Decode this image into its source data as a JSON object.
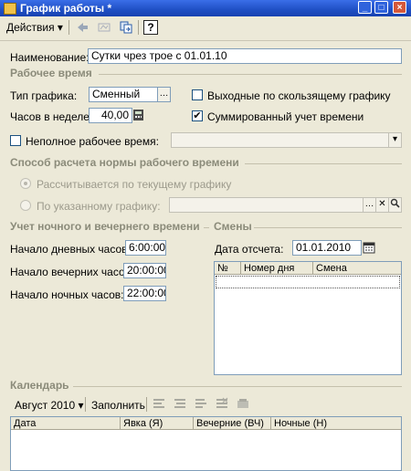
{
  "window": {
    "title": "График работы *"
  },
  "toolbar": {
    "actions_label": "Действия"
  },
  "form": {
    "name_label": "Наименование:",
    "name_value": "Сутки чрез трое с 01.01.10"
  },
  "work_time": {
    "title": "Рабочее время",
    "schedule_type_label": "Тип графика:",
    "schedule_type_value": "Сменный",
    "weekly_hours_label": "Часов в неделе:",
    "weekly_hours_value": "40,00",
    "sliding_weekends_label": "Выходные по скользящему графику",
    "sliding_weekends_checked": false,
    "summarized_label": "Суммированный учет времени",
    "summarized_checked": true,
    "part_time_label": "Неполное рабочее время:",
    "part_time_checked": false,
    "part_time_value": ""
  },
  "norm": {
    "title": "Способ расчета нормы рабочего времени",
    "option_current": "Рассчитывается по текущему графику",
    "option_by_schedule": "По указанному графику:",
    "selected": "current",
    "by_schedule_value": ""
  },
  "night_evening": {
    "title": "Учет ночного и вечернего времени",
    "day_start_label": "Начало дневных часов:",
    "day_start_value": "6:00:00",
    "evening_start_label": "Начало вечерних часов:",
    "evening_start_value": "20:00:00",
    "night_start_label": "Начало ночных часов:",
    "night_start_value": "22:00:00"
  },
  "shifts": {
    "title": "Смены",
    "ref_date_label": "Дата отсчета:",
    "ref_date_value": "01.01.2010",
    "columns": [
      "№",
      "Номер дня",
      "Смена"
    ],
    "rows": []
  },
  "calendar": {
    "title": "Календарь",
    "month_label": "Август 2010",
    "fill_label": "Заполнить",
    "columns": [
      "Дата",
      "Явка (Я)",
      "Вечерние (ВЧ)",
      "Ночные (Н)"
    ],
    "rows": []
  },
  "colors": {
    "title_bar": "#1f4fc4",
    "window_bg": "#ece9d8",
    "field_border": "#7f9db9",
    "section_text": "#8b8b7a"
  }
}
